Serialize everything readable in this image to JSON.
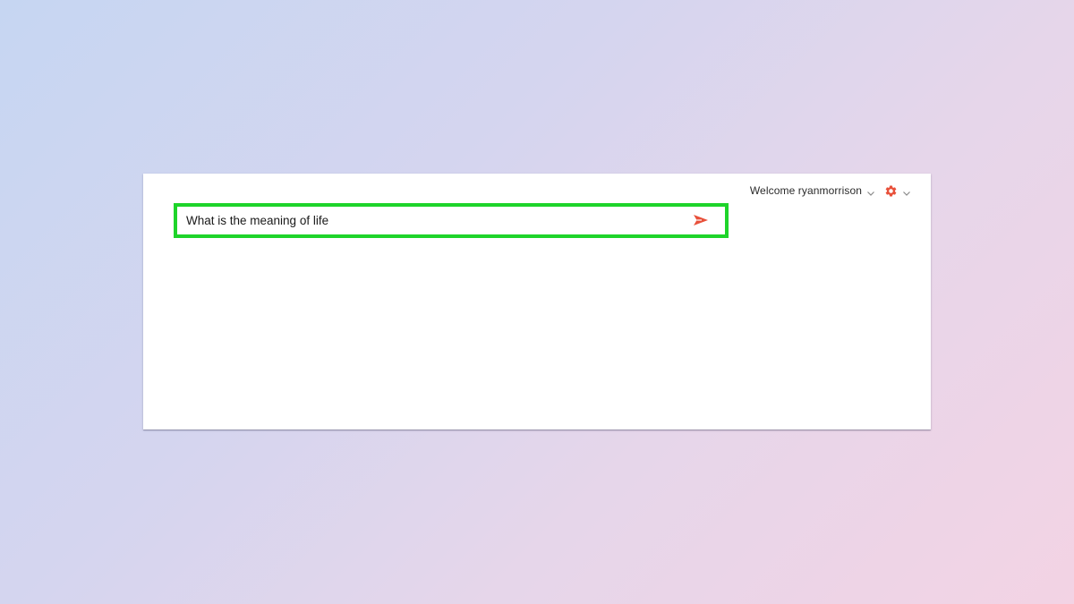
{
  "header": {
    "welcome_text": "Welcome ryanmorrison",
    "icons": {
      "user_dropdown": "chevron-down-icon",
      "settings": "gear-icon",
      "settings_dropdown": "chevron-down-icon"
    }
  },
  "search": {
    "value": "What is the meaning of life",
    "send_icon": "send-icon"
  },
  "colors": {
    "accent": "#e8503a",
    "highlight": "#1ed42a",
    "text": "#1a1a1a"
  }
}
